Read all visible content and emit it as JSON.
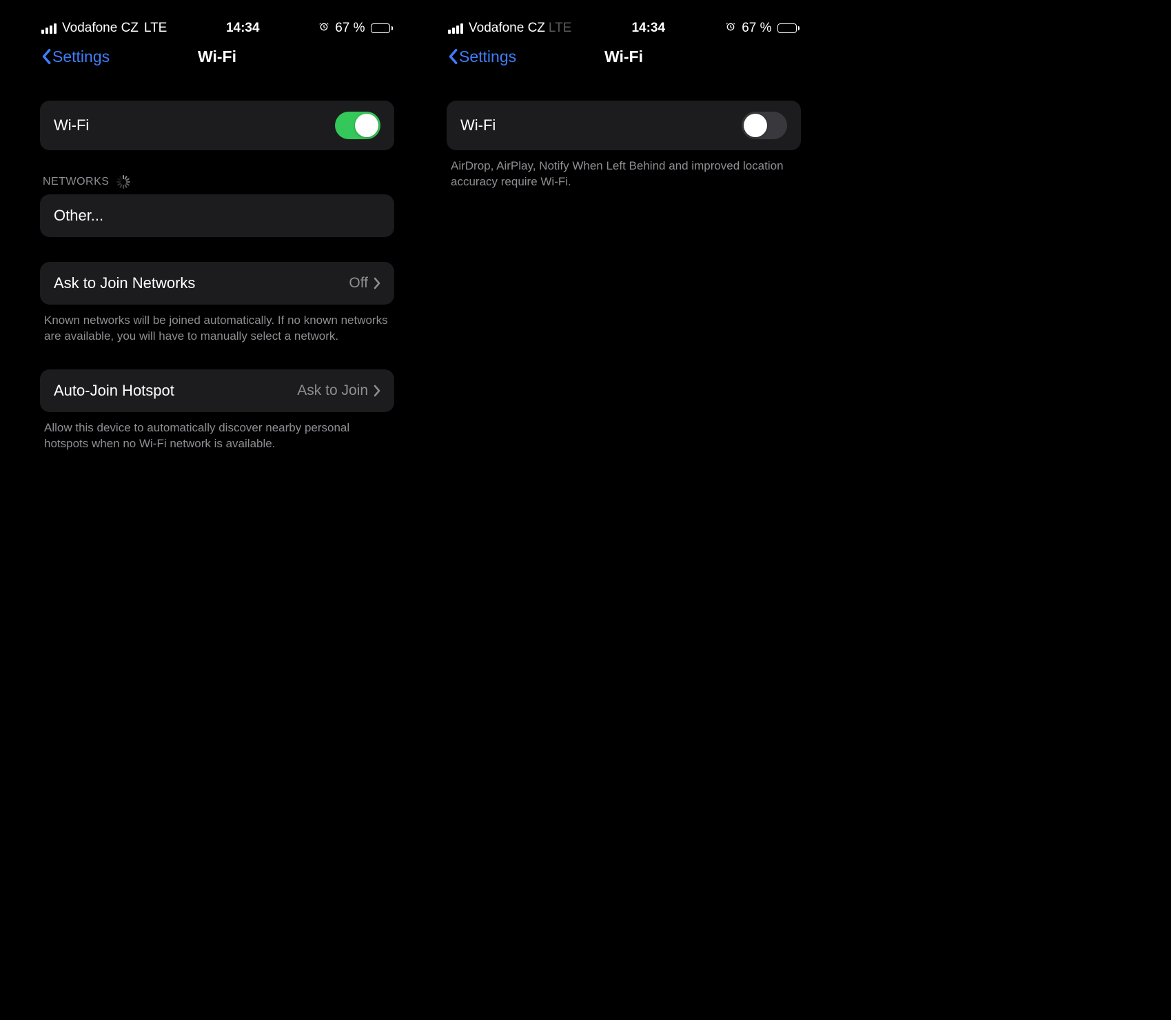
{
  "left": {
    "status": {
      "carrier": "Vodafone CZ",
      "data_mode": "LTE",
      "time": "14:34",
      "battery_text": "67 %"
    },
    "nav": {
      "back_label": "Settings",
      "title": "Wi-Fi"
    },
    "wifi_row": {
      "label": "Wi-Fi",
      "on": true
    },
    "networks": {
      "header": "NETWORKS",
      "other_label": "Other..."
    },
    "ask": {
      "label": "Ask to Join Networks",
      "value": "Off",
      "footer": "Known networks will be joined automatically. If no known networks are available, you will have to manually select a network."
    },
    "hotspot": {
      "label": "Auto-Join Hotspot",
      "value": "Ask to Join",
      "footer": "Allow this device to automatically discover nearby personal hotspots when no Wi-Fi network is available."
    }
  },
  "right": {
    "status": {
      "carrier": "Vodafone CZ",
      "data_mode_faint": "LTE",
      "time": "14:34",
      "battery_text": "67 %"
    },
    "nav": {
      "back_label": "Settings",
      "title": "Wi-Fi"
    },
    "wifi_row": {
      "label": "Wi-Fi",
      "on": false
    },
    "wifi_off_footer": "AirDrop, AirPlay, Notify When Left Behind and improved location accuracy require Wi-Fi."
  }
}
